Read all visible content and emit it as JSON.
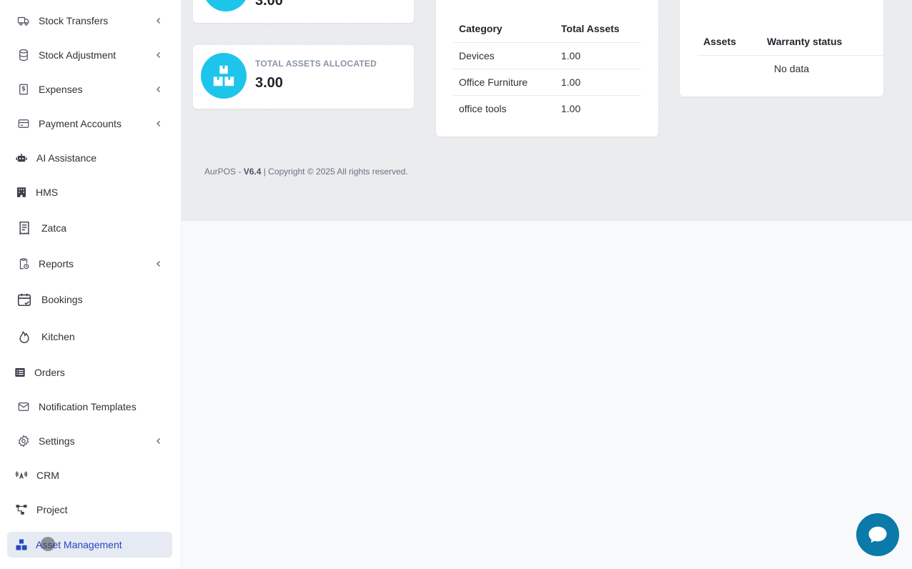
{
  "sidebar": {
    "items": [
      {
        "label": "Stock Transfers",
        "icon": "truck-icon",
        "has_submenu": true
      },
      {
        "label": "Stock Adjustment",
        "icon": "database-icon",
        "has_submenu": true
      },
      {
        "label": "Expenses",
        "icon": "dollar-receipt-icon",
        "has_submenu": true
      },
      {
        "label": "Payment Accounts",
        "icon": "credit-card-icon",
        "has_submenu": true
      },
      {
        "label": "AI Assistance",
        "icon": "robot-icon",
        "has_submenu": false
      },
      {
        "label": "HMS",
        "icon": "building-icon",
        "has_submenu": false
      },
      {
        "label": "Zatca",
        "icon": "receipt-icon",
        "has_submenu": false
      },
      {
        "label": "Reports",
        "icon": "clipboard-clock-icon",
        "has_submenu": true
      },
      {
        "label": "Bookings",
        "icon": "calendar-check-icon",
        "has_submenu": false
      },
      {
        "label": "Kitchen",
        "icon": "flame-icon",
        "has_submenu": false
      },
      {
        "label": "Orders",
        "icon": "list-icon",
        "has_submenu": false
      },
      {
        "label": "Notification Templates",
        "icon": "envelope-icon",
        "has_submenu": false
      },
      {
        "label": "Settings",
        "icon": "gear-icon",
        "has_submenu": true
      },
      {
        "label": "CRM",
        "icon": "broadcast-icon",
        "has_submenu": false
      },
      {
        "label": "Project",
        "icon": "project-tree-icon",
        "has_submenu": false
      },
      {
        "label": "Asset Management",
        "icon": "boxes-icon",
        "has_submenu": false,
        "active": true
      }
    ]
  },
  "stats": {
    "top_partial_value": "3.00",
    "allocated": {
      "label": "TOTAL ASSETS ALLOCATED",
      "value": "3.00"
    }
  },
  "category_table": {
    "headers": [
      "Category",
      "Total Assets"
    ],
    "rows": [
      [
        "Devices",
        "1.00"
      ],
      [
        "Office Furniture",
        "1.00"
      ],
      [
        "office tools",
        "1.00"
      ]
    ]
  },
  "warranty_table": {
    "headers": [
      "Assets",
      "Warranty status"
    ],
    "empty_text": "No data"
  },
  "footer": {
    "brand": "AurPOS - ",
    "version": "V6.4",
    "copyright": " | Copyright © 2025 All rights reserved."
  },
  "colors": {
    "accent_cyan": "#1ec5ea",
    "active_text": "#2547c6",
    "chat_button": "#0a7aa8"
  }
}
